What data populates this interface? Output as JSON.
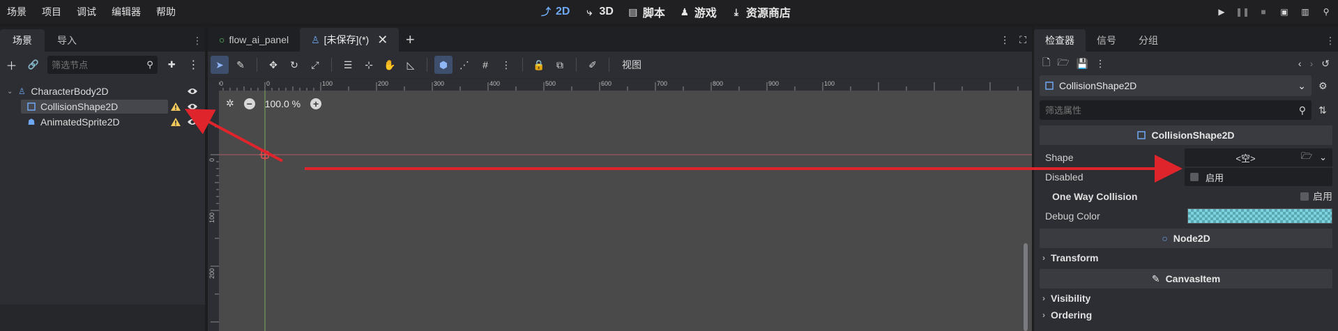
{
  "menu": [
    "场景",
    "项目",
    "调试",
    "编辑器",
    "帮助"
  ],
  "workspaces": [
    {
      "label": "2D",
      "icon": "2d-workspace-icon",
      "active": true
    },
    {
      "label": "3D",
      "icon": "3d-workspace-icon"
    },
    {
      "label": "脚本",
      "icon": "script-workspace-icon"
    },
    {
      "label": "游戏",
      "icon": "game-workspace-icon"
    },
    {
      "label": "资源商店",
      "icon": "asset-library-icon"
    }
  ],
  "scene_dock": {
    "tabs": [
      "场景",
      "导入"
    ],
    "filter_placeholder": "筛选节点",
    "nodes": [
      "CharacterBody2D",
      "CollisionShape2D",
      "AnimatedSprite2D"
    ]
  },
  "editor": {
    "tabs": [
      "flow_ai_panel",
      "[未保存](*)"
    ],
    "view_menu": "视图",
    "zoom": "100.0 %",
    "ruler_x": [
      "-100",
      "0",
      "100",
      "200",
      "300",
      "400",
      "500",
      "600",
      "700",
      "800",
      "900",
      "100"
    ],
    "ruler_y": [
      "0",
      "100",
      "200"
    ]
  },
  "inspector": {
    "tabs": [
      "检查器",
      "信号",
      "分组"
    ],
    "selected_object": "CollisionShape2D",
    "filter_placeholder": "筛选属性",
    "section_title": "CollisionShape2D",
    "shape_label": "Shape",
    "shape_value": "<空>",
    "disabled_label": "Disabled",
    "disabled_check": "启用",
    "one_way_label": "One Way Collision",
    "one_way_check": "启用",
    "debug_color_label": "Debug Color",
    "node2d_header": "Node2D",
    "transform_label": "Transform",
    "canvas_item_header": "CanvasItem",
    "visibility_label": "Visibility",
    "ordering_label": "Ordering"
  },
  "colors": {
    "accent": "#6ea7f2",
    "warning": "#f0c95a",
    "annotation_arrow": "#e0242c",
    "debug_color": "#7dd3dd"
  }
}
